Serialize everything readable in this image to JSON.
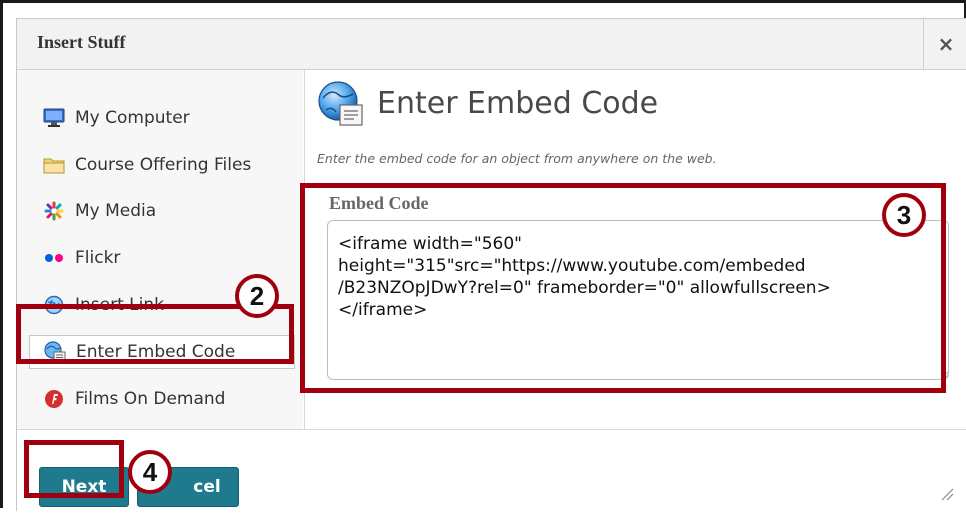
{
  "dialog": {
    "title": "Insert Stuff",
    "close_label": "×"
  },
  "sidebar": {
    "items": [
      {
        "label": "My Computer",
        "icon": "monitor-icon"
      },
      {
        "label": "Course Offering Files",
        "icon": "folder-icon"
      },
      {
        "label": "My Media",
        "icon": "media-icon"
      },
      {
        "label": "Flickr",
        "icon": "flickr-icon"
      },
      {
        "label": "Insert Link",
        "icon": "globe-link-icon"
      },
      {
        "label": "Enter Embed Code",
        "icon": "embed-globe-icon",
        "selected": true
      },
      {
        "label": "Films On Demand",
        "icon": "films-on-demand-icon"
      }
    ]
  },
  "main": {
    "title": "Enter Embed Code",
    "description": "Enter the embed code for an object from anywhere on the web.",
    "embed_label": "Embed Code",
    "embed_value": "<iframe width=\"560\"\nheight=\"315\"src=\"https://www.youtube.com/embeded\n/B23NZOpJDwY?rel=0\" frameborder=\"0\" allowfullscreen>\n</iframe>"
  },
  "footer": {
    "next_label": "Next",
    "cancel_label": "Cancel",
    "cancel_visible": "cel"
  },
  "annotations": {
    "step2": "2",
    "step3": "3",
    "step4": "4",
    "highlight_color": "#a0000e"
  },
  "colors": {
    "button": "#1e7a8c",
    "accent": "#a0000e"
  }
}
